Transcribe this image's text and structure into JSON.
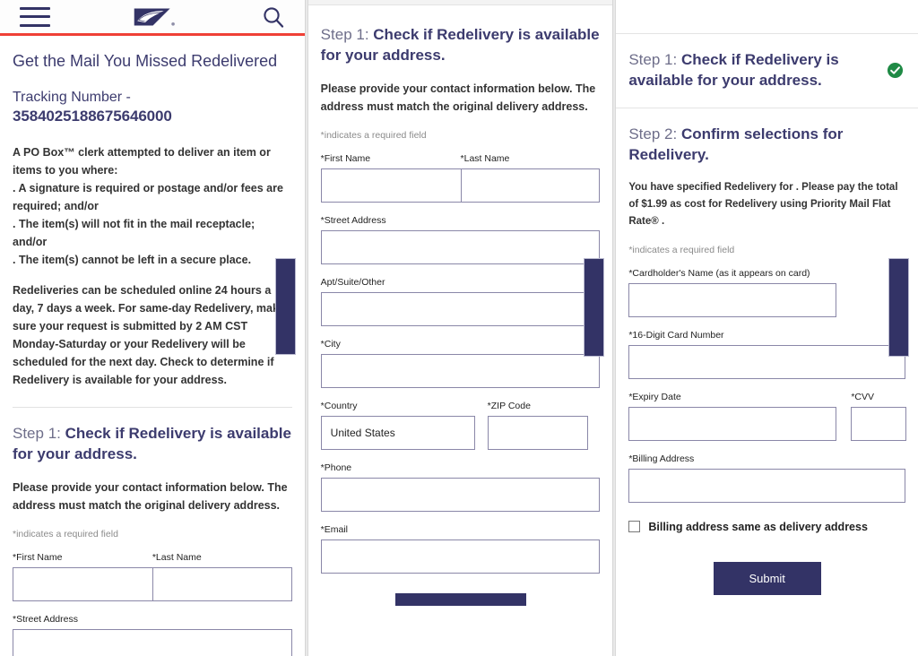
{
  "header": {
    "menu_icon": "hamburger-menu-icon",
    "logo_icon": "usps-eagle-logo",
    "search_icon": "search-icon",
    "accent_color": "#ef4036",
    "brand_navy": "#333366"
  },
  "panel1": {
    "title": "Get the Mail You Missed Redelivered",
    "tracking_label": "Tracking Number -",
    "tracking_number": "3584025188675646000",
    "body_block_1": "A PO Box™ clerk attempted to deliver an item or items to you where:\n. A signature is required or postage and/or fees are required; and/or\n. The item(s) will not fit in the mail receptacle; and/or\n. The item(s) cannot be left in a secure place.",
    "body_block_2": "Redeliveries can be scheduled online 24 hours a day, 7 days a week. For same-day Redelivery, make sure your request is submitted by 2 AM CST Monday-Saturday or your Redelivery will be scheduled for the next day. Check to determine if Redelivery is available for your address.",
    "step_label": "Step 1:",
    "step_title": "Check if Redelivery is available for your address.",
    "lead": "Please provide your contact information below. The address must match the original delivery address.",
    "required_note": "*indicates a required field",
    "fields": {
      "first_name": {
        "label": "*First Name",
        "value": ""
      },
      "last_name": {
        "label": "*Last Name",
        "value": ""
      },
      "street_address": {
        "label": "*Street Address",
        "value": ""
      }
    }
  },
  "panel2": {
    "step_label": "Step 1:",
    "step_title": "Check if Redelivery is available for your address.",
    "lead": "Please provide your contact information below. The address must match the original delivery address.",
    "required_note": "*indicates a required field",
    "fields": {
      "first_name": {
        "label": "*First Name",
        "value": ""
      },
      "last_name": {
        "label": "*Last Name",
        "value": ""
      },
      "street_address": {
        "label": "*Street Address",
        "value": ""
      },
      "apt": {
        "label": "Apt/Suite/Other",
        "value": ""
      },
      "city": {
        "label": "*City",
        "value": ""
      },
      "country": {
        "label": "*Country",
        "value": "United States"
      },
      "zip": {
        "label": "*ZIP Code",
        "value": ""
      },
      "phone": {
        "label": "*Phone",
        "value": ""
      },
      "email": {
        "label": "*Email",
        "value": ""
      }
    }
  },
  "panel3": {
    "step1_label": "Step 1:",
    "step1_title": "Check if Redelivery is available for your address.",
    "step1_status_icon": "green-check-circle-icon",
    "step1_status_color": "#1f8a45",
    "step2_label": "Step 2:",
    "step2_title": "Confirm selections for Redelivery.",
    "summary": "You have specified Redelivery for . Please pay the total of $1.99 as cost for Redelivery using Priority Mail Flat Rate® .",
    "amount": "$1.99",
    "service": "Priority Mail Flat Rate®",
    "required_note": "*indicates a required field",
    "fields": {
      "cardholder": {
        "label": "*Cardholder's Name (as it appears on card)",
        "value": ""
      },
      "card_number": {
        "label": "*16-Digit Card Number",
        "value": ""
      },
      "expiry": {
        "label": "*Expiry Date",
        "value": ""
      },
      "cvv": {
        "label": "*CVV",
        "value": ""
      },
      "billing_address": {
        "label": "*Billing Address",
        "value": ""
      }
    },
    "checkbox_label": "Billing address same as delivery address",
    "checkbox_checked": false,
    "submit_label": "Submit"
  }
}
